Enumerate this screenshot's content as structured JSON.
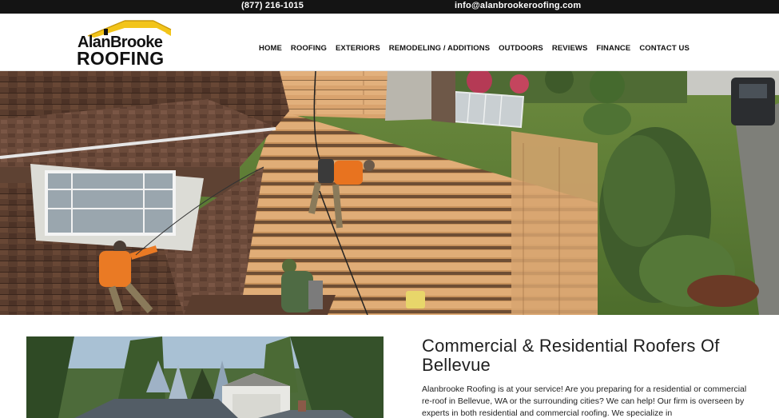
{
  "topbar": {
    "phone": "(877) 216-1015",
    "email": "info@alanbrookeroofing.com"
  },
  "logo": {
    "line1": "AlanBrooke",
    "line2": "ROOFING"
  },
  "nav": {
    "items": [
      "HOME",
      "ROOFING",
      "EXTERIORS",
      "REMODELING / ADDITIONS",
      "OUTDOORS",
      "REVIEWS",
      "FINANCE",
      "CONTACT US"
    ]
  },
  "content": {
    "heading": "Commercial & Residential Roofers Of Bellevue",
    "body": "Alanbrooke Roofing is at your service! Are you preparing for a residential or commercial re-roof in Bellevue, WA or the surrounding cities? We can help! Our firm is overseen by experts in both residential and commercial roofing. We specialize in"
  },
  "colors": {
    "topbar_bg": "#141414",
    "logo_accent": "#f2c41a"
  }
}
